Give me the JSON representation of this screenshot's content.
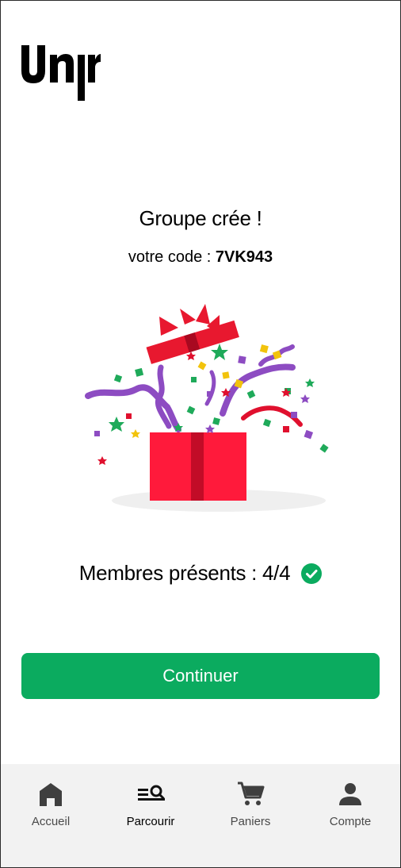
{
  "app": {
    "logo_text": "Unjr"
  },
  "main": {
    "title": "Groupe crée !",
    "code_prefix": "votre code : ",
    "code_value": "7VK943",
    "members_text": "Membres présents : 4/4",
    "continue_label": "Continuer"
  },
  "colors": {
    "accent": "#0bab5f",
    "nav_background": "#f2f2f2"
  },
  "bottom_nav": {
    "items": [
      {
        "label": "Accueil",
        "icon": "home-icon"
      },
      {
        "label": "Parcourir",
        "icon": "browse-search-icon",
        "active": true
      },
      {
        "label": "Paniers",
        "icon": "cart-icon"
      },
      {
        "label": "Compte",
        "icon": "account-icon"
      }
    ]
  }
}
